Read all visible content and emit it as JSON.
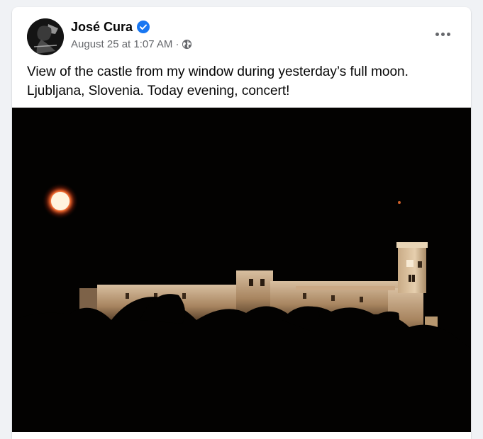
{
  "post": {
    "author": "José Cura",
    "timestamp": "August 25 at 1:07 AM",
    "separator": "·",
    "text_line1": "View of the castle from my window during yesterday’s full moon.",
    "text_line2": "Ljubljana, Slovenia. Today evening, concert!",
    "audience_icon": "globe-icon",
    "verified_icon": "verified-badge-icon",
    "more_icon": "more-options-icon"
  },
  "colors": {
    "background": "#f0f2f5",
    "card": "#ffffff",
    "text_primary": "#050505",
    "text_secondary": "#65676b",
    "verified_blue": "#1877f2"
  }
}
